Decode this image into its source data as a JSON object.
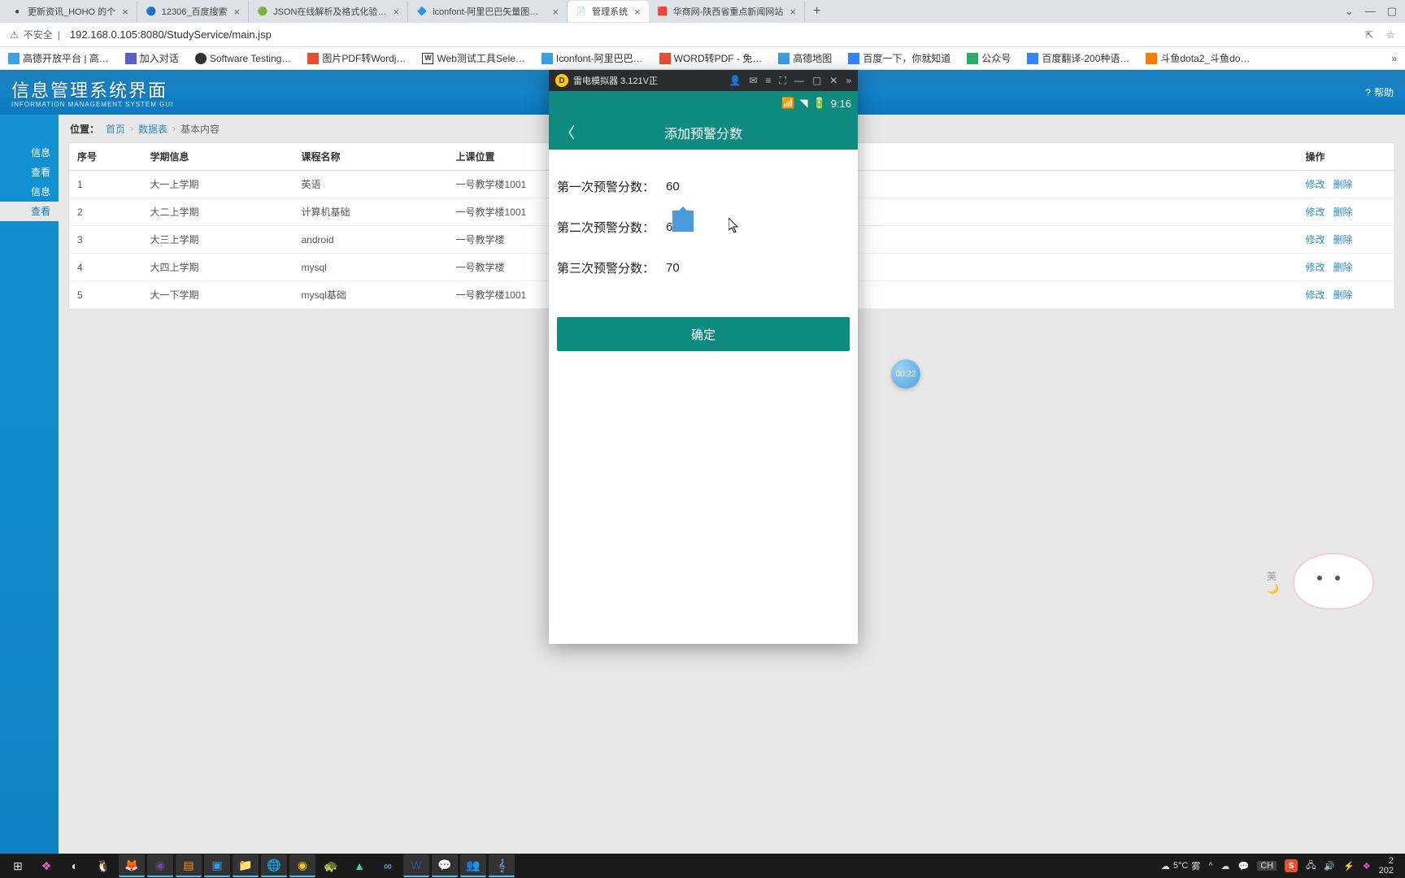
{
  "browser": {
    "tabs": [
      {
        "title": "更新资讯_HOHO 的个",
        "favicon": "●"
      },
      {
        "title": "12306_百度搜索",
        "favicon": "🔵"
      },
      {
        "title": "JSON在线解析及格式化验证 - J",
        "favicon": "🟢"
      },
      {
        "title": "iconfont-阿里巴巴矢量图标库",
        "favicon": "🔷"
      },
      {
        "title": "管理系统",
        "favicon": "📄",
        "active": true
      },
      {
        "title": "华商网-陕西省重点新闻网站",
        "favicon": "🟥"
      }
    ],
    "insecure_label": "不安全",
    "url": "192.168.0.105:8080/StudyService/main.jsp",
    "bookmarks": [
      "高德开放平台 | 高…",
      "加入对话",
      "Software Testing…",
      "图片PDF转Wordj…",
      "Web测试工具Sele…",
      "Iconfont-阿里巴巴…",
      "WORD转PDF - 免…",
      "高德地图",
      "百度一下，你就知道",
      "公众号",
      "百度翻译-200种语…",
      "斗鱼dota2_斗鱼do…"
    ]
  },
  "page": {
    "system_title": "信息管理系统界面",
    "system_sub": "INFORMATION MANAGEMENT SYSTEM GUI",
    "help_label": "帮助",
    "sidebar": [
      "信息",
      "查看",
      "信息",
      "查看"
    ],
    "sidebar_active_index": 3,
    "breadcrumb": {
      "label": "位置：",
      "items": [
        "首页",
        "数据表",
        "基本内容"
      ]
    },
    "table": {
      "headers": [
        "序号",
        "学期信息",
        "课程名称",
        "上课位置",
        "操作"
      ],
      "action_edit": "修改",
      "action_delete": "删除",
      "rows": [
        {
          "idx": "1",
          "semester": "大一上学期",
          "course": "英语",
          "location": "一号教学楼1001"
        },
        {
          "idx": "2",
          "semester": "大二上学期",
          "course": "计算机基础",
          "location": "一号教学楼1001"
        },
        {
          "idx": "3",
          "semester": "大三上学期",
          "course": "android",
          "location": "一号教学楼"
        },
        {
          "idx": "4",
          "semester": "大四上学期",
          "course": "mysql",
          "location": "一号教学楼"
        },
        {
          "idx": "5",
          "semester": "大一下学期",
          "course": "mysql基础",
          "location": "一号教学楼1001"
        }
      ]
    }
  },
  "emu": {
    "title": "雷电模拟器 3.121V正",
    "status_time": "9:16",
    "app_title": "添加预警分数",
    "rows": [
      {
        "label": "第一次预警分数：",
        "value": "60"
      },
      {
        "label": "第二次预警分数：",
        "value": "65"
      },
      {
        "label": "第三次预警分数：",
        "value": "70"
      }
    ],
    "confirm": "确定"
  },
  "timer": "00:22",
  "ime": {
    "lang": "英",
    "mode": "🌙"
  },
  "taskbar": {
    "weather_temp": "5°C",
    "weather_text": "雾",
    "ime_short": "CH",
    "datetime1": "2",
    "datetime2": "202"
  }
}
